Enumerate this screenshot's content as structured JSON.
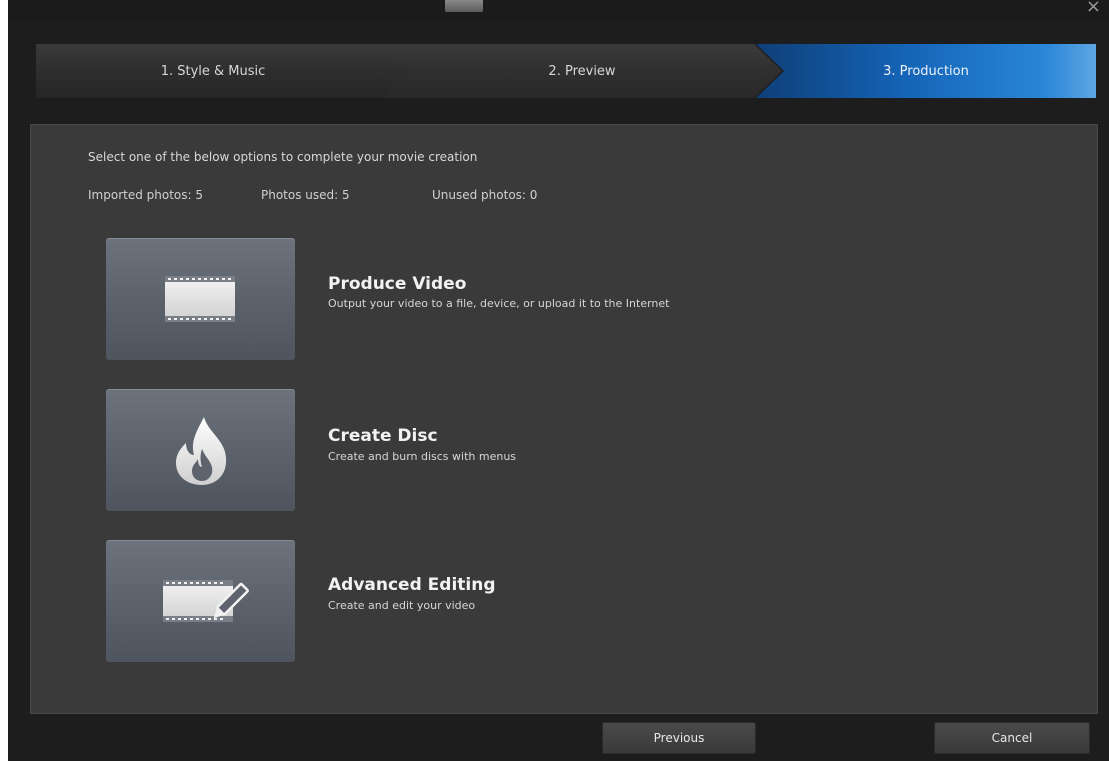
{
  "steps": [
    {
      "label": "1. Style & Music",
      "state": "done"
    },
    {
      "label": "2. Preview",
      "state": "done"
    },
    {
      "label": "3. Production",
      "state": "active"
    }
  ],
  "instruction": "Select one of the below options to complete your movie creation",
  "stats": {
    "imported": "Imported photos: 5",
    "used": "Photos used: 5",
    "unused": "Unused photos: 0"
  },
  "options": [
    {
      "title": "Produce Video",
      "desc": "Output your video to a file, device, or upload it to the Internet",
      "icon": "film-strip-icon"
    },
    {
      "title": "Create Disc",
      "desc": "Create and burn discs with menus",
      "icon": "flame-icon"
    },
    {
      "title": "Advanced Editing",
      "desc": "Create and edit your video",
      "icon": "film-edit-icon"
    }
  ],
  "footer": {
    "previous": "Previous",
    "cancel": "Cancel"
  },
  "colors": {
    "window_bg": "#1d1d1d",
    "panel_bg": "#3a3a3a",
    "active_step": "#1565b8",
    "tile": "#5b616b"
  }
}
